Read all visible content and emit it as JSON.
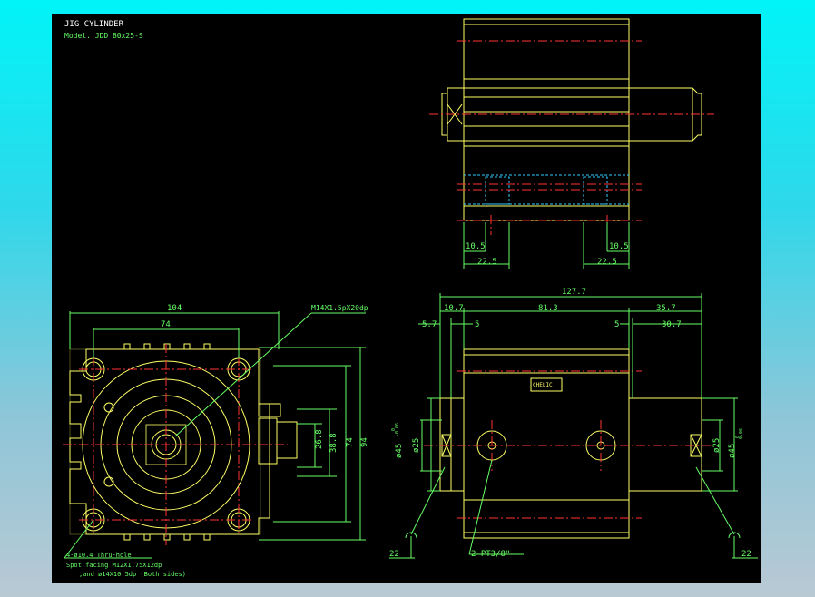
{
  "title": {
    "line1": "JIG CYLINDER",
    "line2": "Model. JDD 80x25-S"
  },
  "top_view": {
    "dim_10_5_left": "10.5",
    "dim_22_5_left": "22.5",
    "dim_10_5_right": "10.5",
    "dim_22_5_right": "22.5"
  },
  "end_view": {
    "dim_104": "104",
    "dim_74_top": "74",
    "dim_26_8": "26.8",
    "dim_38_8": "38.8",
    "dim_74_side": "74",
    "dim_94": "94",
    "note_thread": "M14X1.5pX20dp",
    "note_holes_1": "4-ø10.4 Thru-hole",
    "note_holes_2": "Spot facing M12X1.75X12dp",
    "note_holes_3": ",and ø14X10.5dp (Both sides)"
  },
  "side_view": {
    "dim_127_7": "127.7",
    "dim_10_7": "10.7",
    "dim_81_3": "81.3",
    "dim_35_7": "35.7",
    "dim_5_7": "5.7",
    "dim_5_a": "5",
    "dim_5_b": "5",
    "dim_30_7": "30.7",
    "dim_phi45_left": "ø45",
    "tol_left_top": "0",
    "tol_left_bot": "-0.06",
    "dim_phi25_left": "ø25",
    "dim_phi25_right": "ø25",
    "dim_phi45_right": "ø45",
    "tol_right_top": "0",
    "tol_right_bot": "-0.06",
    "port_note": "2-PT3/8\"",
    "dim_22_left": "22",
    "dim_22_right": "22",
    "label_text": "CHELIC"
  },
  "colors": {
    "background": "#000000",
    "outline": "#ffff66",
    "dimension": "#66ff66",
    "centerline": "#ff3333",
    "hidden": "#33ccff",
    "detail": "#ffff99"
  }
}
